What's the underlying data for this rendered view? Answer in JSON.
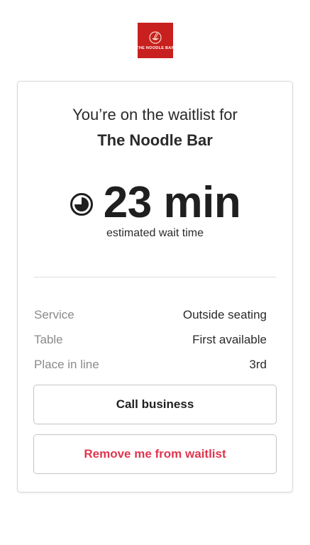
{
  "brand": {
    "logo_text": "THE NOODLE BAR",
    "logo_color": "#c8201f"
  },
  "waitlist": {
    "headline": "You’re on the waitlist for",
    "business_name": "The Noodle Bar",
    "wait_time": "23 min",
    "wait_caption": "estimated wait time",
    "icon": "clock-icon"
  },
  "details": [
    {
      "label": "Service",
      "value": "Outside seating"
    },
    {
      "label": "Table",
      "value": "First available"
    },
    {
      "label": "Place in line",
      "value": "3rd"
    }
  ],
  "actions": {
    "call_label": "Call business",
    "remove_label": "Remove me from waitlist",
    "remove_color": "#e0364f"
  }
}
